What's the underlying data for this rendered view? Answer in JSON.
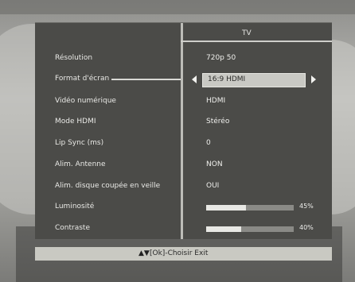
{
  "menu": {
    "tab_title": "TV",
    "rows": [
      {
        "label": "Résolution",
        "value": "720p 50"
      },
      {
        "label": "Format d'écran",
        "value": "16:9 HDMI"
      },
      {
        "label": "Vidéo numérique",
        "value": "HDMI"
      },
      {
        "label": "Mode HDMI",
        "value": "Stéréo"
      },
      {
        "label": "Lip Sync (ms)",
        "value": "0"
      },
      {
        "label": "Alim. Antenne",
        "value": "NON"
      },
      {
        "label": "Alim. disque coupée en veille",
        "value": "OUI"
      },
      {
        "label": "Luminosité",
        "level": 45,
        "level_text": "45%"
      },
      {
        "label": "Contraste",
        "level": 40,
        "level_text": "40%"
      }
    ]
  },
  "help": {
    "icon": "up-down-arrows-icon",
    "text": "[Ok]-Choisir  Exit"
  }
}
